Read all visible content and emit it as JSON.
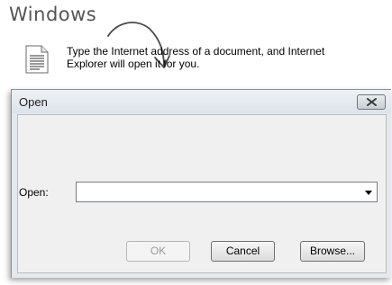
{
  "annotation": {
    "text": "Windows"
  },
  "dialog": {
    "title": "Open",
    "close_icon": "close-x-icon",
    "document_icon": "document-icon",
    "prompt": "Type the Internet address of a document, and Internet Explorer will open it for you.",
    "field_label": "Open:",
    "field_value": "",
    "buttons": {
      "ok": "OK",
      "cancel": "Cancel",
      "browse": "Browse..."
    },
    "ok_enabled": false
  }
}
